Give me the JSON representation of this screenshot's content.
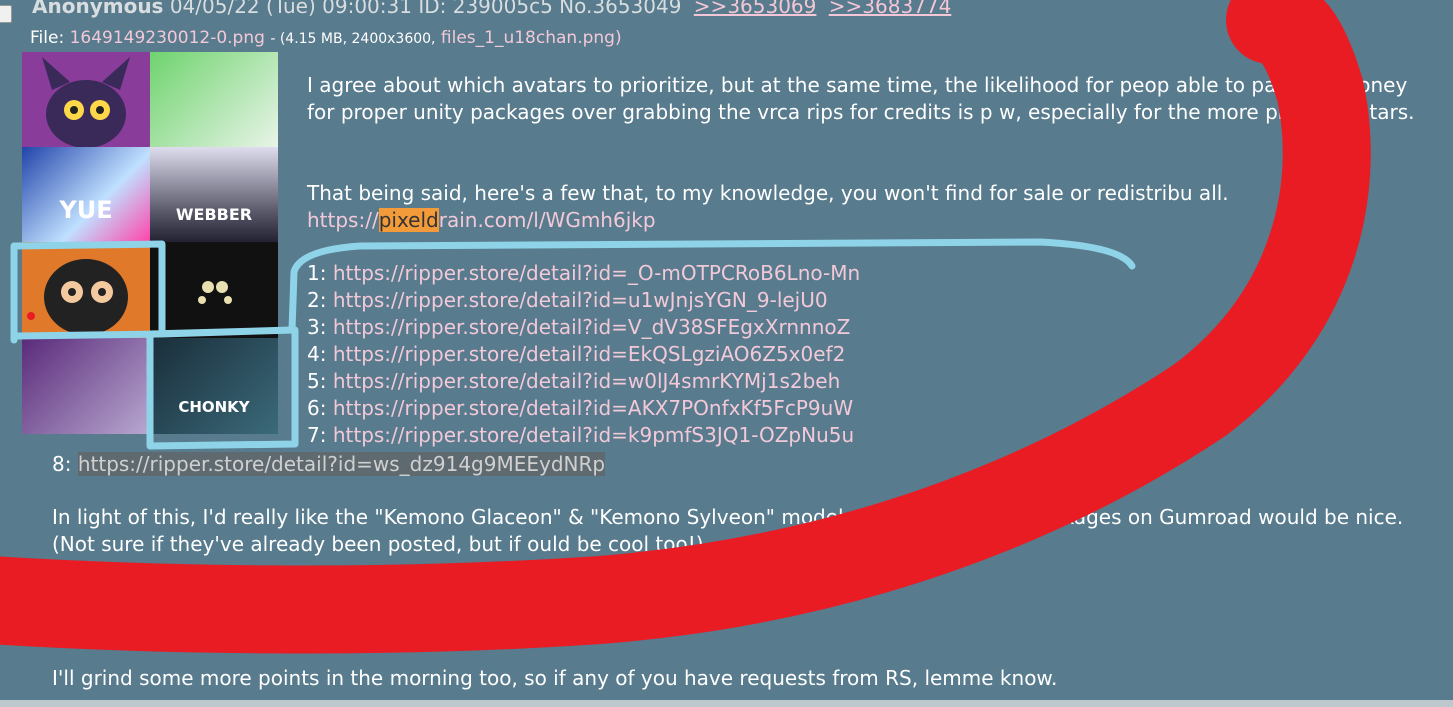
{
  "post": {
    "name": "Anonymous",
    "datetime": "04/05/22 (Tue) 09:00:31",
    "id": "ID: 239005c5",
    "no": "No.3653049",
    "backlinks": [
      ">>3653069",
      ">>3683774"
    ]
  },
  "file": {
    "label": "File:",
    "filename": "1649149230012-0.png",
    "info": "- (4.15 MB, 2400x3600,",
    "original": "files_1_u18chan.png)"
  },
  "thumbnails": [
    {
      "label": ""
    },
    {
      "label": ""
    },
    {
      "label": "YUE"
    },
    {
      "label": "WEBBER"
    },
    {
      "label": ""
    },
    {
      "label": ""
    },
    {
      "label": ""
    },
    {
      "label": "CHONKY"
    }
  ],
  "body": {
    "p1": "I agree about which avatars to prioritize, but at the same time, the likelihood for peop      able to pay real money for proper unity packages over grabbing the vrca rips for credits is p        w, especially for the more pricey avatars.",
    "p2": "That being said, here's a few that, to my knowledge, you won't find for sale or redistribu        all.",
    "pixeldrain": {
      "pre": "https://",
      "hl": "pixeld",
      "post": "rain.com/l/WGmh6jkp"
    },
    "links": [
      {
        "n": "1:",
        "url": "https://ripper.store/detail?id=_O-mOTPCRoB6Lno-Mn"
      },
      {
        "n": "2:",
        "url": "https://ripper.store/detail?id=u1wJnjsYGN_9-lejU0"
      },
      {
        "n": "3:",
        "url": "https://ripper.store/detail?id=V_dV38SFEgxXrnnnoZ"
      },
      {
        "n": "4:",
        "url": "https://ripper.store/detail?id=EkQSLgziAO6Z5x0ef2"
      },
      {
        "n": "5:",
        "url": "https://ripper.store/detail?id=w0lJ4smrKYMj1s2beh"
      },
      {
        "n": "6:",
        "url": "https://ripper.store/detail?id=AKX7POnfxKf5FcP9uW"
      },
      {
        "n": "7:",
        "url": "https://ripper.store/detail?id=k9pmfS3JQ1-OZpNu5u"
      }
    ],
    "link8": {
      "n": "8:",
      "url": "https://ripper.store/detail?id=ws_dz914g9MEEydNRp"
    },
    "p3": "In light of this, I'd really like the \"Kemono Glaceon\" & \"Kemono Sylveon\" models. Th         , but the full packages on Gumroad would be nice. (Not sure if they've already been posted, but if                  ould be cool too!)",
    "p4": "I'll grind some more points in the morning too, so if any of you have requests from RS, lemme know."
  },
  "colors": {
    "background": "#587b8d",
    "link": "#f2c9d8",
    "highlight": "#f39a3a",
    "red_scribble": "#e91c24",
    "blue_scribble": "#8fd3e8"
  }
}
